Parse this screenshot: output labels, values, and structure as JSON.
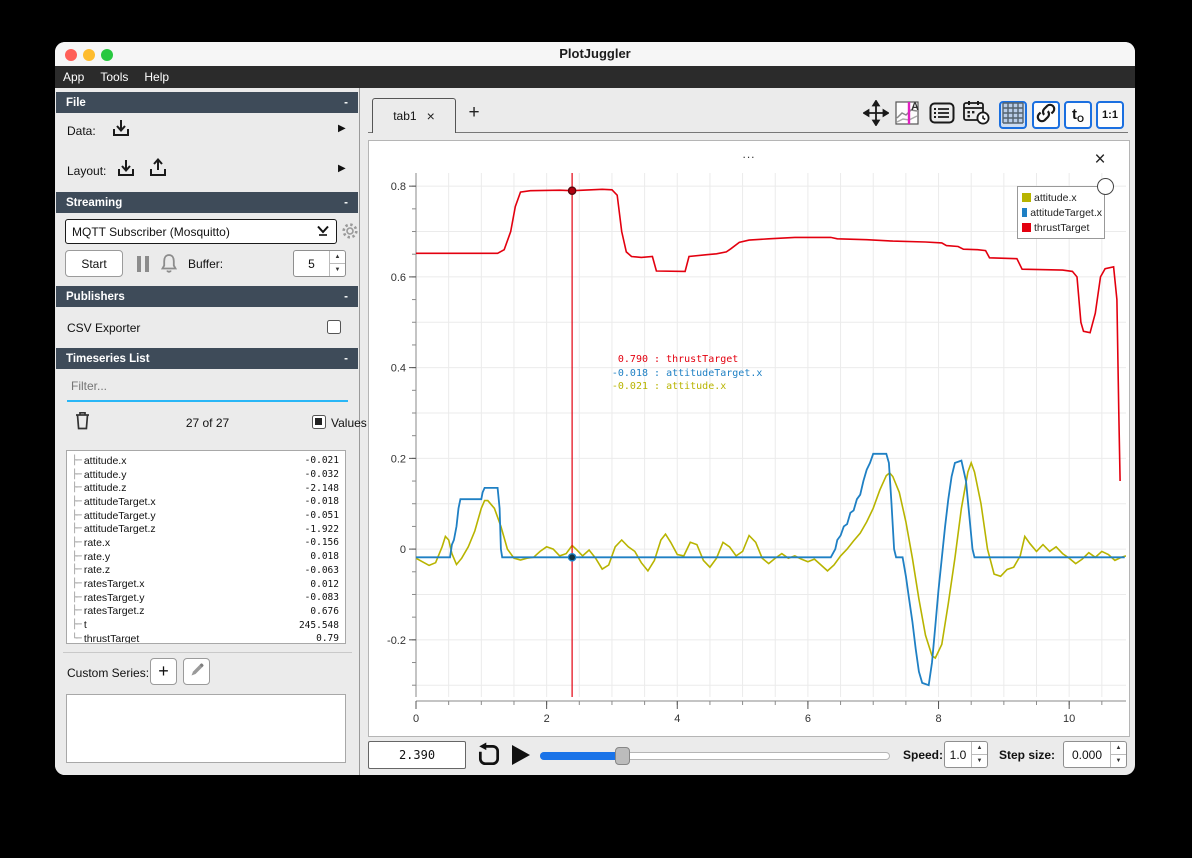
{
  "glyphs": {
    "minus": "-",
    "close": "×",
    "add": "+",
    "arrow_right": "▶",
    "up": "▲",
    "down": "▼",
    "branch": "├─",
    "branch_last": "└─"
  },
  "window": {
    "title": "PlotJuggler",
    "menu": [
      {
        "label": "App"
      },
      {
        "label": "Tools"
      },
      {
        "label": "Help"
      }
    ]
  },
  "sidebar": {
    "file": {
      "title": "File",
      "data_label": "Data:",
      "layout_label": "Layout:"
    },
    "streaming": {
      "title": "Streaming",
      "source_selected": "MQTT Subscriber (Mosquitto)",
      "start_label": "Start",
      "buffer_label": "Buffer:",
      "buffer_value": "5"
    },
    "publishers": {
      "title": "Publishers",
      "csv_label": "CSV Exporter",
      "csv_checked": false
    },
    "timeseries": {
      "title": "Timeseries List",
      "filter_placeholder": "Filter...",
      "count_text": "27 of 27",
      "values_label": "Values",
      "values_checked": true,
      "items": [
        {
          "name": "attitude.x",
          "value": "-0.021"
        },
        {
          "name": "attitude.y",
          "value": "-0.032"
        },
        {
          "name": "attitude.z",
          "value": "-2.148"
        },
        {
          "name": "attitudeTarget.x",
          "value": "-0.018"
        },
        {
          "name": "attitudeTarget.y",
          "value": "-0.051"
        },
        {
          "name": "attitudeTarget.z",
          "value": "-1.922"
        },
        {
          "name": "rate.x",
          "value": "-0.156"
        },
        {
          "name": "rate.y",
          "value": "0.018"
        },
        {
          "name": "rate.z",
          "value": "-0.063"
        },
        {
          "name": "ratesTarget.x",
          "value": "0.012"
        },
        {
          "name": "ratesTarget.y",
          "value": "-0.083"
        },
        {
          "name": "ratesTarget.z",
          "value": "0.676"
        },
        {
          "name": "t",
          "value": "245.548"
        },
        {
          "name": "thrustTarget",
          "value": "0.79"
        }
      ]
    },
    "custom_series": {
      "label": "Custom Series:"
    }
  },
  "tabbar": {
    "tab_label": "tab1",
    "toolbar": {
      "tzero_main": "t",
      "tzero_sub": "O",
      "ratio_label": "1:1"
    }
  },
  "plot": {
    "title_dots": "...",
    "legend": [
      {
        "label": "attitude.x",
        "color": "#b8b400"
      },
      {
        "label": "attitudeTarget.x",
        "color": "#1f80c4"
      },
      {
        "label": "thrustTarget",
        "color": "#e3000f"
      }
    ],
    "tracker_readout": [
      {
        "value": "0.790",
        "name": "thrustTarget",
        "color": "#e3000f"
      },
      {
        "value": "-0.018",
        "name": "attitudeTarget.x",
        "color": "#1f80c4"
      },
      {
        "value": "-0.021",
        "name": "attitude.x",
        "color": "#b8b400"
      }
    ]
  },
  "chart_data": {
    "type": "line",
    "title": "...",
    "xlim": [
      0,
      10.87
    ],
    "ylim": [
      -0.326,
      0.829
    ],
    "xticks": {
      "values": [
        0,
        2,
        4,
        6,
        8,
        10
      ],
      "labels": [
        "0",
        "2",
        "4",
        "6",
        "8",
        "10"
      ],
      "minor_step": 0.5
    },
    "yticks": {
      "values": [
        -0.2,
        0,
        0.2,
        0.4,
        0.6,
        0.8
      ],
      "labels": [
        "-0.2",
        "0",
        "0.2",
        "0.4",
        "0.6",
        "0.8"
      ],
      "minor_step": 0.05
    },
    "grid": {
      "x_step": 0.5,
      "y_step": 0.1,
      "color": "#ebebeb"
    },
    "legend_position": "top-right",
    "tracker": {
      "x": 2.39,
      "points": [
        {
          "series": "thrustTarget",
          "y": 0.79,
          "dot": "#b00010",
          "edge": "#57060c"
        },
        {
          "series": "attitudeTarget.x",
          "y": -0.018,
          "dot": "#12313f",
          "edge": "#1f80c4"
        }
      ]
    },
    "series": [
      {
        "name": "attitude.x",
        "color": "#b8b400",
        "width": 1.6,
        "points": [
          [
            0,
            -0.02
          ],
          [
            0.1,
            -0.028
          ],
          [
            0.2,
            -0.036
          ],
          [
            0.3,
            -0.03
          ],
          [
            0.4,
            0.005
          ],
          [
            0.45,
            0.028
          ],
          [
            0.5,
            0.02
          ],
          [
            0.55,
            -0.01
          ],
          [
            0.62,
            -0.034
          ],
          [
            0.7,
            -0.02
          ],
          [
            0.8,
            0.005
          ],
          [
            0.9,
            0.04
          ],
          [
            1.0,
            0.09
          ],
          [
            1.05,
            0.107
          ],
          [
            1.1,
            0.107
          ],
          [
            1.2,
            0.09
          ],
          [
            1.3,
            0.05
          ],
          [
            1.4,
            0.0
          ],
          [
            1.5,
            -0.02
          ],
          [
            1.6,
            -0.024
          ],
          [
            1.7,
            -0.02
          ],
          [
            1.8,
            -0.018
          ],
          [
            1.9,
            -0.005
          ],
          [
            2.0,
            0.005
          ],
          [
            2.1,
            0.0
          ],
          [
            2.2,
            -0.015
          ],
          [
            2.3,
            -0.01
          ],
          [
            2.39,
            0.008
          ],
          [
            2.45,
            0.0
          ],
          [
            2.55,
            -0.015
          ],
          [
            2.65,
            -0.002
          ],
          [
            2.75,
            -0.02
          ],
          [
            2.85,
            -0.044
          ],
          [
            2.95,
            -0.035
          ],
          [
            3.05,
            0.005
          ],
          [
            3.15,
            0.02
          ],
          [
            3.25,
            0.005
          ],
          [
            3.35,
            -0.005
          ],
          [
            3.45,
            -0.03
          ],
          [
            3.55,
            -0.048
          ],
          [
            3.65,
            -0.025
          ],
          [
            3.75,
            0.02
          ],
          [
            3.82,
            0.033
          ],
          [
            3.9,
            0.015
          ],
          [
            4.0,
            -0.012
          ],
          [
            4.1,
            -0.015
          ],
          [
            4.2,
            0.015
          ],
          [
            4.3,
            0.01
          ],
          [
            4.4,
            -0.025
          ],
          [
            4.5,
            -0.04
          ],
          [
            4.6,
            -0.02
          ],
          [
            4.7,
            0.015
          ],
          [
            4.8,
            0.005
          ],
          [
            4.9,
            -0.015
          ],
          [
            5.0,
            -0.005
          ],
          [
            5.1,
            0.03
          ],
          [
            5.2,
            0.015
          ],
          [
            5.3,
            -0.02
          ],
          [
            5.4,
            -0.032
          ],
          [
            5.5,
            -0.02
          ],
          [
            5.6,
            -0.01
          ],
          [
            5.7,
            -0.02
          ],
          [
            5.8,
            -0.015
          ],
          [
            5.9,
            -0.022
          ],
          [
            6.0,
            -0.028
          ],
          [
            6.1,
            -0.022
          ],
          [
            6.2,
            -0.035
          ],
          [
            6.3,
            -0.048
          ],
          [
            6.4,
            -0.035
          ],
          [
            6.5,
            -0.015
          ],
          [
            6.6,
            0.0
          ],
          [
            6.7,
            0.018
          ],
          [
            6.8,
            0.035
          ],
          [
            6.9,
            0.06
          ],
          [
            7.0,
            0.09
          ],
          [
            7.1,
            0.13
          ],
          [
            7.2,
            0.162
          ],
          [
            7.25,
            0.168
          ],
          [
            7.3,
            0.16
          ],
          [
            7.4,
            0.125
          ],
          [
            7.5,
            0.06
          ],
          [
            7.6,
            -0.02
          ],
          [
            7.7,
            -0.11
          ],
          [
            7.8,
            -0.19
          ],
          [
            7.9,
            -0.235
          ],
          [
            7.95,
            -0.24
          ],
          [
            8.05,
            -0.21
          ],
          [
            8.15,
            -0.12
          ],
          [
            8.25,
            -0.02
          ],
          [
            8.35,
            0.09
          ],
          [
            8.45,
            0.17
          ],
          [
            8.5,
            0.19
          ],
          [
            8.55,
            0.17
          ],
          [
            8.65,
            0.1
          ],
          [
            8.75,
            0.0
          ],
          [
            8.85,
            -0.055
          ],
          [
            8.95,
            -0.06
          ],
          [
            9.05,
            -0.045
          ],
          [
            9.15,
            -0.04
          ],
          [
            9.25,
            -0.015
          ],
          [
            9.32,
            0.028
          ],
          [
            9.4,
            0.012
          ],
          [
            9.5,
            -0.005
          ],
          [
            9.6,
            0.01
          ],
          [
            9.7,
            -0.005
          ],
          [
            9.8,
            0.005
          ],
          [
            9.9,
            -0.01
          ],
          [
            10.0,
            -0.02
          ],
          [
            10.1,
            -0.032
          ],
          [
            10.2,
            -0.022
          ],
          [
            10.3,
            -0.008
          ],
          [
            10.4,
            -0.018
          ],
          [
            10.5,
            -0.005
          ],
          [
            10.6,
            -0.012
          ],
          [
            10.7,
            -0.025
          ],
          [
            10.8,
            -0.018
          ],
          [
            10.87,
            -0.015
          ]
        ]
      },
      {
        "name": "attitudeTarget.x",
        "color": "#1f80c4",
        "width": 1.8,
        "points": [
          [
            0,
            -0.018
          ],
          [
            0.52,
            -0.018
          ],
          [
            0.55,
            0.01
          ],
          [
            0.58,
            0.02
          ],
          [
            0.62,
            0.05
          ],
          [
            0.65,
            0.09
          ],
          [
            0.68,
            0.11
          ],
          [
            1.0,
            0.11
          ],
          [
            1.02,
            0.125
          ],
          [
            1.05,
            0.135
          ],
          [
            1.25,
            0.135
          ],
          [
            1.28,
            0.09
          ],
          [
            1.3,
            0.0
          ],
          [
            1.32,
            -0.018
          ],
          [
            6.35,
            -0.018
          ],
          [
            6.42,
            0.0
          ],
          [
            6.45,
            0.02
          ],
          [
            6.5,
            0.03
          ],
          [
            6.55,
            0.05
          ],
          [
            6.6,
            0.055
          ],
          [
            6.65,
            0.08
          ],
          [
            6.7,
            0.085
          ],
          [
            6.75,
            0.11
          ],
          [
            6.8,
            0.12
          ],
          [
            6.85,
            0.15
          ],
          [
            6.9,
            0.175
          ],
          [
            6.95,
            0.19
          ],
          [
            7.0,
            0.21
          ],
          [
            7.2,
            0.21
          ],
          [
            7.24,
            0.19
          ],
          [
            7.28,
            0.1
          ],
          [
            7.32,
            0.0
          ],
          [
            7.35,
            -0.018
          ],
          [
            7.45,
            -0.018
          ],
          [
            7.5,
            -0.06
          ],
          [
            7.55,
            -0.11
          ],
          [
            7.6,
            -0.16
          ],
          [
            7.65,
            -0.22
          ],
          [
            7.7,
            -0.27
          ],
          [
            7.75,
            -0.295
          ],
          [
            7.85,
            -0.3
          ],
          [
            7.9,
            -0.25
          ],
          [
            7.95,
            -0.17
          ],
          [
            8.0,
            -0.09
          ],
          [
            8.05,
            -0.02
          ],
          [
            8.1,
            0.05
          ],
          [
            8.15,
            0.11
          ],
          [
            8.2,
            0.16
          ],
          [
            8.25,
            0.19
          ],
          [
            8.35,
            0.195
          ],
          [
            8.42,
            0.15
          ],
          [
            8.48,
            0.06
          ],
          [
            8.52,
            0.0
          ],
          [
            8.55,
            -0.018
          ],
          [
            10.85,
            -0.018
          ]
        ]
      },
      {
        "name": "thrustTarget",
        "color": "#e3000f",
        "width": 1.6,
        "points": [
          [
            0,
            0.652
          ],
          [
            1.25,
            0.652
          ],
          [
            1.35,
            0.66
          ],
          [
            1.45,
            0.7
          ],
          [
            1.52,
            0.755
          ],
          [
            1.6,
            0.787
          ],
          [
            1.75,
            0.79
          ],
          [
            2.2,
            0.791
          ],
          [
            2.39,
            0.79
          ],
          [
            2.85,
            0.793
          ],
          [
            3.0,
            0.792
          ],
          [
            3.08,
            0.78
          ],
          [
            3.15,
            0.7
          ],
          [
            3.22,
            0.655
          ],
          [
            3.3,
            0.645
          ],
          [
            3.45,
            0.643
          ],
          [
            3.62,
            0.645
          ],
          [
            3.68,
            0.613
          ],
          [
            4.12,
            0.612
          ],
          [
            4.18,
            0.645
          ],
          [
            4.45,
            0.649
          ],
          [
            4.6,
            0.651
          ],
          [
            4.75,
            0.655
          ],
          [
            4.82,
            0.662
          ],
          [
            4.95,
            0.676
          ],
          [
            5.1,
            0.681
          ],
          [
            5.4,
            0.684
          ],
          [
            5.8,
            0.687
          ],
          [
            6.35,
            0.687
          ],
          [
            6.45,
            0.684
          ],
          [
            6.9,
            0.682
          ],
          [
            7.3,
            0.679
          ],
          [
            7.8,
            0.677
          ],
          [
            8.05,
            0.675
          ],
          [
            8.12,
            0.669
          ],
          [
            8.3,
            0.667
          ],
          [
            8.38,
            0.661
          ],
          [
            8.6,
            0.66
          ],
          [
            8.72,
            0.658
          ],
          [
            8.78,
            0.642
          ],
          [
            9.2,
            0.64
          ],
          [
            9.28,
            0.617
          ],
          [
            9.9,
            0.615
          ],
          [
            10.05,
            0.612
          ],
          [
            10.12,
            0.6
          ],
          [
            10.18,
            0.5
          ],
          [
            10.22,
            0.48
          ],
          [
            10.32,
            0.477
          ],
          [
            10.4,
            0.52
          ],
          [
            10.48,
            0.6
          ],
          [
            10.55,
            0.618
          ],
          [
            10.68,
            0.622
          ],
          [
            10.73,
            0.55
          ],
          [
            10.76,
            0.3
          ],
          [
            10.78,
            0.15
          ]
        ]
      }
    ]
  },
  "bottombar": {
    "time_value": "2.390",
    "speed_label": "Speed:",
    "speed_value": "1.0",
    "step_label": "Step size:",
    "step_value": "0.000"
  }
}
